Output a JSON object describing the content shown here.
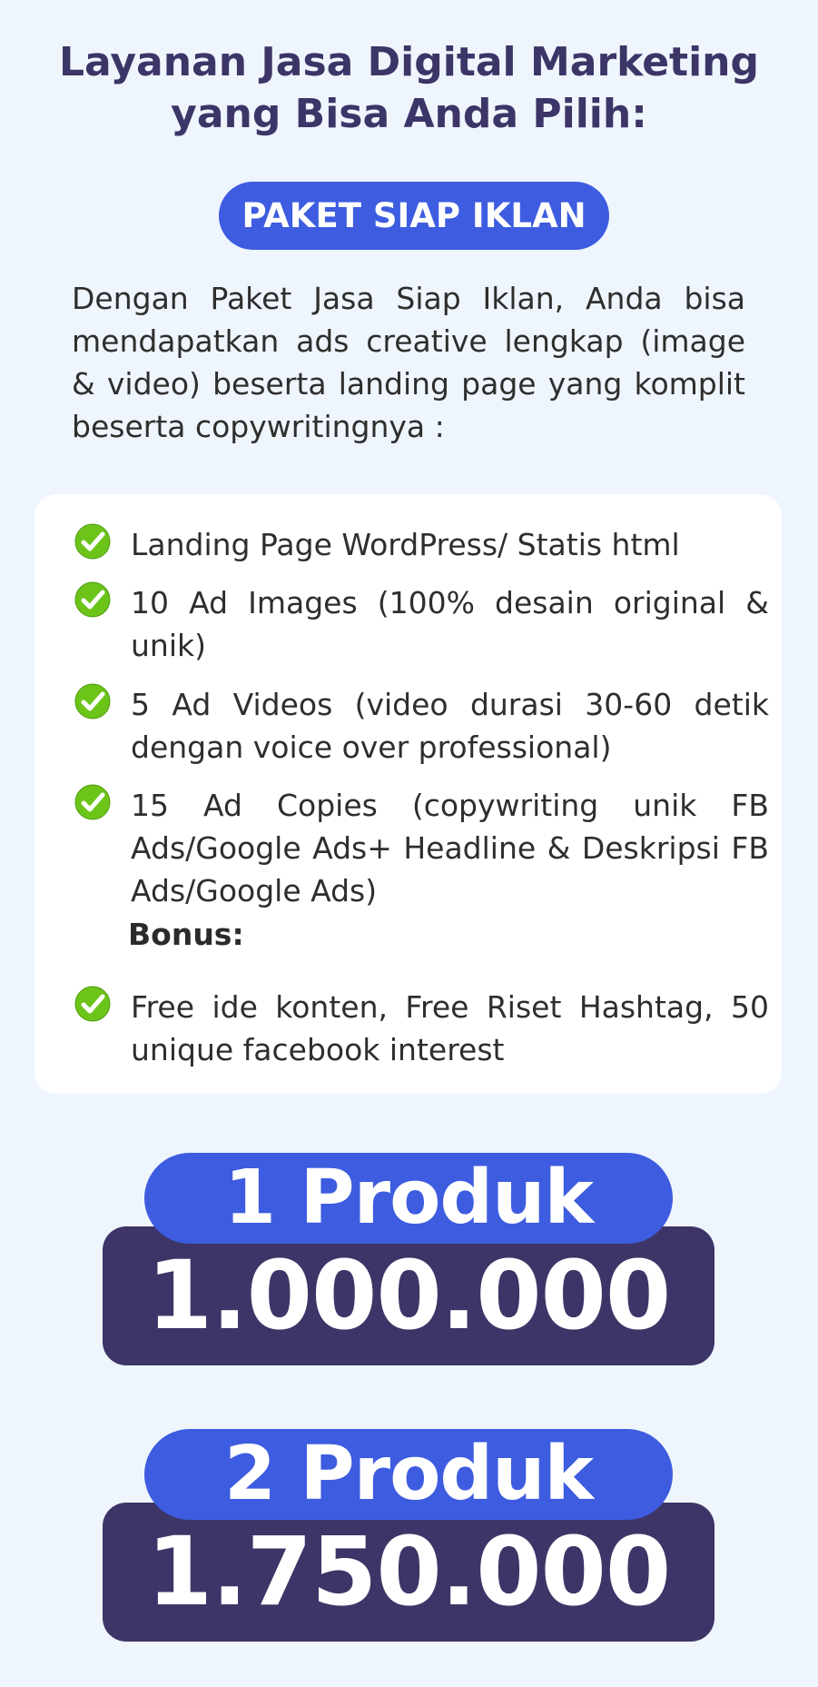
{
  "header": {
    "title_line1": "Layanan Jasa Digital Marketing",
    "title_line2": "yang Bisa Anda Pilih:"
  },
  "package": {
    "name": "PAKET SIAP IKLAN",
    "description": "Dengan Paket Jasa Siap Iklan, Anda bisa mendapatkan ads creative lengkap (image & video) beserta landing page yang komplit beserta copywritingnya :"
  },
  "features": [
    {
      "icon": "check-circle-icon",
      "text": "Landing Page WordPress/ Statis html"
    },
    {
      "icon": "check-circle-icon",
      "text": "10 Ad Images (100% desain original & unik)"
    },
    {
      "icon": "check-circle-icon",
      "text": "5 Ad Videos (video durasi 30-60 detik dengan voice over professional)"
    },
    {
      "icon": "check-circle-icon",
      "text": "15 Ad Copies (copywriting unik FB Ads/Google Ads+ Headline & Deskripsi FB Ads/Google Ads)"
    }
  ],
  "bonus": {
    "label": "Bonus:",
    "icon": "check-circle-icon",
    "text": "Free ide konten, Free Riset Hashtag, 50 unique facebook interest"
  },
  "pricing": [
    {
      "product": "1 Produk",
      "price": "1.000.000"
    },
    {
      "product": "2 Produk",
      "price": "1.750.000"
    }
  ],
  "colors": {
    "background": "#eff5fd",
    "title": "#3c3567",
    "accent_blue": "#3d5ce0",
    "price_dark": "#3d3567",
    "check_green": "#6cc419"
  }
}
